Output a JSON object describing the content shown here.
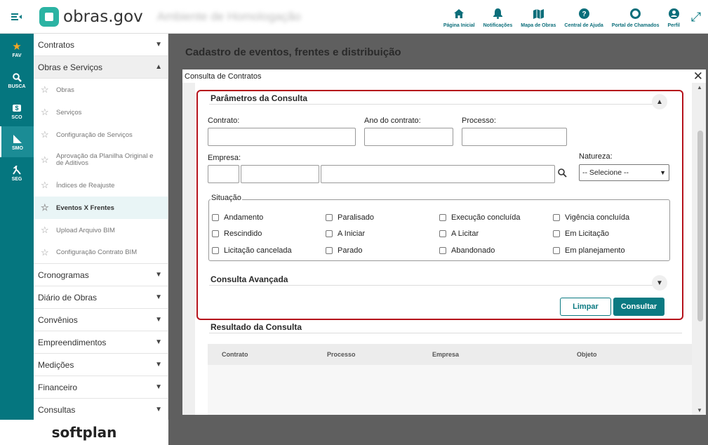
{
  "app": {
    "logo_text": "obras.gov",
    "environment": "Ambiente de Homologação",
    "footer_brand": "softplan"
  },
  "topnav": [
    {
      "label": "Página Inicial",
      "icon": "home-icon"
    },
    {
      "label": "Notificações",
      "icon": "bell-icon"
    },
    {
      "label": "Mapa de Obras",
      "icon": "map-icon"
    },
    {
      "label": "Central de Ajuda",
      "icon": "help-icon"
    },
    {
      "label": "Portal de Chamados",
      "icon": "lifebuoy-icon"
    },
    {
      "label": "Perfil",
      "icon": "user-icon"
    }
  ],
  "rail": [
    {
      "label": "FAV",
      "glyph": "★"
    },
    {
      "label": "BUSCA",
      "glyph": "🔍"
    },
    {
      "label": "SCO",
      "glyph": "$"
    },
    {
      "label": "SMO",
      "glyph": "◣"
    },
    {
      "label": "SEG",
      "glyph": "⤧"
    }
  ],
  "sidebar": {
    "sections": [
      {
        "label": "Contratos"
      },
      {
        "label": "Obras e Serviços"
      },
      {
        "label": "Cronogramas"
      },
      {
        "label": "Diário de Obras"
      },
      {
        "label": "Convênios"
      },
      {
        "label": "Empreendimentos"
      },
      {
        "label": "Medições"
      },
      {
        "label": "Financeiro"
      },
      {
        "label": "Consultas"
      }
    ],
    "sub_items": [
      {
        "label": "Obras"
      },
      {
        "label": "Serviços"
      },
      {
        "label": "Configuração de Serviços"
      },
      {
        "label": "Aprovação da Planilha Original e de Aditivos"
      },
      {
        "label": "Índices de Reajuste"
      },
      {
        "label": "Eventos X Frentes"
      },
      {
        "label": "Upload Arquivo BIM"
      },
      {
        "label": "Configuração Contrato BIM"
      }
    ]
  },
  "page": {
    "title": "Cadastro de eventos, frentes e distribuição"
  },
  "modal": {
    "title": "Consulta de Contratos",
    "params_title": "Parâmetros da Consulta",
    "fields": {
      "contrato": "Contrato:",
      "ano": "Ano do contrato:",
      "processo": "Processo:",
      "empresa": "Empresa:",
      "natureza": "Natureza:",
      "natureza_value": "-- Selecione --"
    },
    "situacao_legend": "Situação",
    "situacoes": [
      "Andamento",
      "Paralisado",
      "Execução concluída",
      "Vigência concluída",
      "Rescindido",
      "A Iniciar",
      "A Licitar",
      "Em Licitação",
      "Licitação cancelada",
      "Parado",
      "Abandonado",
      "Em planejamento"
    ],
    "advanced_title": "Consulta Avançada",
    "buttons": {
      "limpar": "Limpar",
      "consultar": "Consultar"
    },
    "results_title": "Resultado da Consulta",
    "columns": [
      "Contrato",
      "Processo",
      "Empresa",
      "Objeto"
    ]
  },
  "colors": {
    "teal": "#0b7a82",
    "highlight_border": "#b5121b"
  }
}
